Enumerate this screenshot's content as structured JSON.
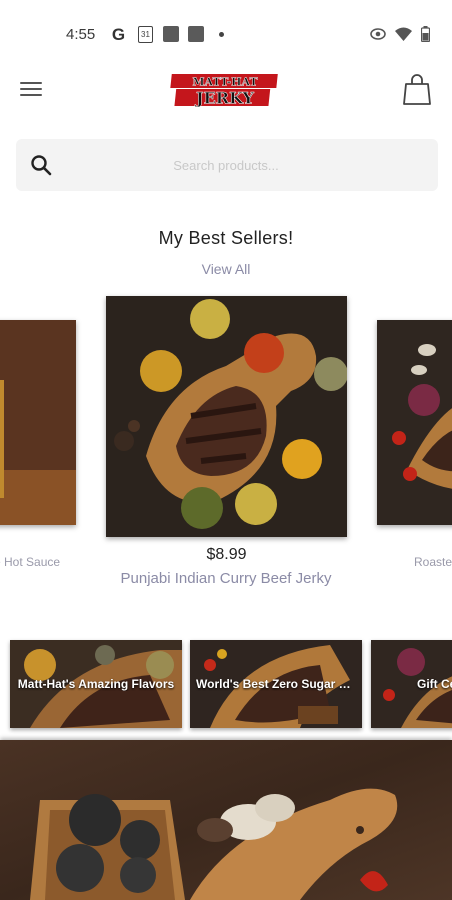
{
  "status_bar": {
    "time": "4:55",
    "icons": [
      "google-icon",
      "calendar-icon",
      "app-icon",
      "app-icon",
      "dot-icon",
      "eye-icon",
      "wifi-icon",
      "battery-icon"
    ],
    "calendar_day": "31"
  },
  "header": {
    "logo_line1": "MATT-HAT",
    "logo_line2": "JERKY",
    "menu_icon": "hamburger-menu-icon",
    "cart_icon": "shopping-bag-icon"
  },
  "search": {
    "placeholder": "Search products..."
  },
  "best_sellers": {
    "title": "My Best Sellers!",
    "view_all": "View All",
    "featured": {
      "price": "$8.99",
      "name": "Punjabi Indian Curry Beef Jerky"
    },
    "left_peek_name": "e Hot Sauce",
    "right_peek_name": "Roaste"
  },
  "categories": [
    {
      "label": "Matt-Hat's Amazing Flavors"
    },
    {
      "label": "World's Best Zero Sugar Ket..."
    },
    {
      "label": "Gift Ce"
    }
  ],
  "colors": {
    "accent_text": "#8b8ba6",
    "logo_red": "#c4161c",
    "search_bg": "#f3f3f3"
  }
}
